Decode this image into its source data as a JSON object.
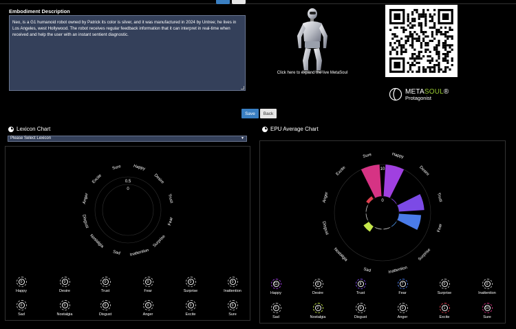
{
  "embodiment": {
    "title": "Embodiment Description",
    "text": "Neo, is a G1 humanoid robot owned by Patrick its color is silver, and it was manufactured in 2024 by Untree; he lives in Los Angeles, west Hollywood. The robot receives regular feedback information that it can interpret in real-time when received and help the user with an instant sentient diagnostic."
  },
  "avatar": {
    "caption": "Click here to expand the live MetaSoul"
  },
  "brand": {
    "name_part1": "META",
    "name_part2": "SOUL",
    "name_mark": "®",
    "subtitle": "Protagonist"
  },
  "actions": {
    "save": "Save",
    "back": "Back"
  },
  "lexicon": {
    "title": "Lexicon Chart",
    "select_value": "Please Select Lexicon",
    "scale_outer": "0.5",
    "scale_inner": "0"
  },
  "epu": {
    "title": "EPU Average Chart",
    "scale_outer": "10",
    "scale_inner": "0"
  },
  "emotions": [
    "Sure",
    "Happy",
    "Desire",
    "Trust",
    "Fear",
    "Surprise",
    "Inattention",
    "Sad",
    "Nostalgia",
    "Disgust",
    "Anger",
    "Excite"
  ],
  "dial_order": [
    "Happy",
    "Desire",
    "Trust",
    "Fear",
    "Surprise",
    "Inattention",
    "Sad",
    "Nostalgia",
    "Disgust",
    "Anger",
    "Excite",
    "Sure"
  ],
  "lexicon_values": [
    0,
    0,
    0,
    0,
    0,
    0,
    0,
    0,
    0,
    0,
    0,
    0
  ],
  "epu_values": [
    11,
    0,
    8,
    7,
    0,
    0,
    0,
    2,
    0,
    0,
    1,
    10
  ],
  "colors": {
    "Sure": "#d63384",
    "Happy": "#a040e0",
    "Desire": "#8a44e8",
    "Trust": "#7c4ae6",
    "Fear": "#4a7be8",
    "Surprise": "#4a90e2",
    "Inattention": "#cccccc",
    "Sad": "#cccccc",
    "Nostalgia": "#c6e84a",
    "Disgust": "#cccccc",
    "Anger": "#cccccc",
    "Excite": "#e04050",
    "accent_button": "#3a7fc2"
  },
  "chart_data": [
    {
      "type": "polar-bar",
      "title": "Lexicon Chart",
      "categories": [
        "Sure",
        "Happy",
        "Desire",
        "Trust",
        "Fear",
        "Surprise",
        "Inattention",
        "Sad",
        "Nostalgia",
        "Disgust",
        "Anger",
        "Excite"
      ],
      "values": [
        0,
        0,
        0,
        0,
        0,
        0,
        0,
        0,
        0,
        0,
        0,
        0
      ],
      "rlim": [
        0,
        0.5
      ]
    },
    {
      "type": "polar-bar",
      "title": "EPU Average Chart",
      "categories": [
        "Sure",
        "Happy",
        "Desire",
        "Trust",
        "Fear",
        "Surprise",
        "Inattention",
        "Sad",
        "Nostalgia",
        "Disgust",
        "Anger",
        "Excite"
      ],
      "values": [
        10,
        11,
        0,
        8,
        7,
        0,
        0,
        0,
        2,
        0,
        0,
        1
      ],
      "rlim": [
        0,
        10
      ]
    }
  ]
}
